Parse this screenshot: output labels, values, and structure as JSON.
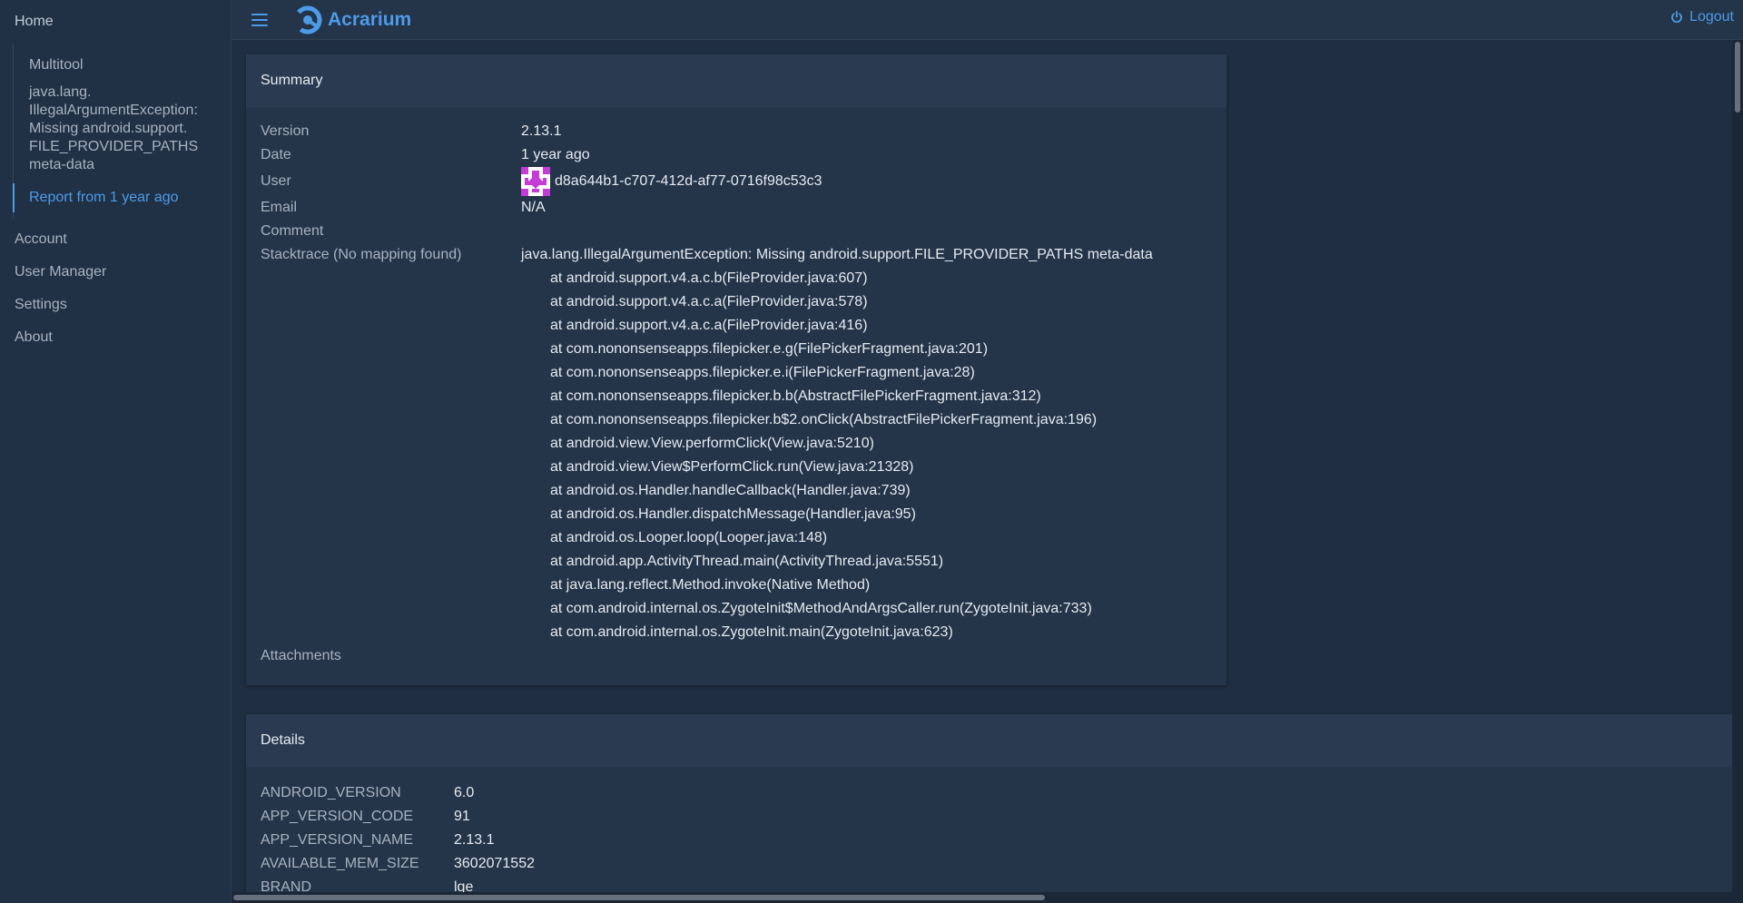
{
  "sidebar": {
    "home": "Home",
    "multitool": "Multitool",
    "exception": "java.lang.\nIllegalArgumentException:\nMissing android.support.\nFILE_PROVIDER_PATHS\nmeta-data",
    "report": "Report from 1 year ago",
    "items": [
      {
        "label": "Account"
      },
      {
        "label": "User Manager"
      },
      {
        "label": "Settings"
      },
      {
        "label": "About"
      }
    ]
  },
  "header": {
    "app_name": "Acrarium",
    "logout": "Logout"
  },
  "summary": {
    "title": "Summary",
    "rows": {
      "version": {
        "label": "Version",
        "value": "2.13.1"
      },
      "date": {
        "label": "Date",
        "value": "1 year ago"
      },
      "user": {
        "label": "User",
        "value": "d8a644b1-c707-412d-af77-0716f98c53c3"
      },
      "email": {
        "label": "Email",
        "value": "N/A"
      },
      "comment": {
        "label": "Comment",
        "value": ""
      },
      "stacktrace": {
        "label": "Stacktrace (No mapping found)"
      },
      "attachments": {
        "label": "Attachments"
      }
    },
    "stacktrace": [
      "java.lang.IllegalArgumentException: Missing android.support.FILE_PROVIDER_PATHS meta-data",
      "at android.support.v4.a.c.b(FileProvider.java:607)",
      "at android.support.v4.a.c.a(FileProvider.java:578)",
      "at android.support.v4.a.c.a(FileProvider.java:416)",
      "at com.nononsenseapps.filepicker.e.g(FilePickerFragment.java:201)",
      "at com.nononsenseapps.filepicker.e.i(FilePickerFragment.java:28)",
      "at com.nononsenseapps.filepicker.b.b(AbstractFilePickerFragment.java:312)",
      "at com.nononsenseapps.filepicker.b$2.onClick(AbstractFilePickerFragment.java:196)",
      "at android.view.View.performClick(View.java:5210)",
      "at android.view.View$PerformClick.run(View.java:21328)",
      "at android.os.Handler.handleCallback(Handler.java:739)",
      "at android.os.Handler.dispatchMessage(Handler.java:95)",
      "at android.os.Looper.loop(Looper.java:148)",
      "at android.app.ActivityThread.main(ActivityThread.java:5551)",
      "at java.lang.reflect.Method.invoke(Native Method)",
      "at com.android.internal.os.ZygoteInit$MethodAndArgsCaller.run(ZygoteInit.java:733)",
      "at com.android.internal.os.ZygoteInit.main(ZygoteInit.java:623)"
    ]
  },
  "details": {
    "title": "Details",
    "rows": [
      {
        "key": "ANDROID_VERSION",
        "value": "6.0"
      },
      {
        "key": "APP_VERSION_CODE",
        "value": "91"
      },
      {
        "key": "APP_VERSION_NAME",
        "value": "2.13.1"
      },
      {
        "key": "AVAILABLE_MEM_SIZE",
        "value": "3602071552"
      },
      {
        "key": "BRAND",
        "value": "lge"
      }
    ]
  },
  "icons": {
    "menu": "menu-icon",
    "logo": "acrarium-logo-icon",
    "logout": "power-icon",
    "avatar": "user-identicon"
  },
  "colors": {
    "accent": "#4d9be8",
    "background": "#1f2e40",
    "card": "#243449",
    "card_header": "#2a3b51",
    "avatar": "#c43bd6"
  }
}
